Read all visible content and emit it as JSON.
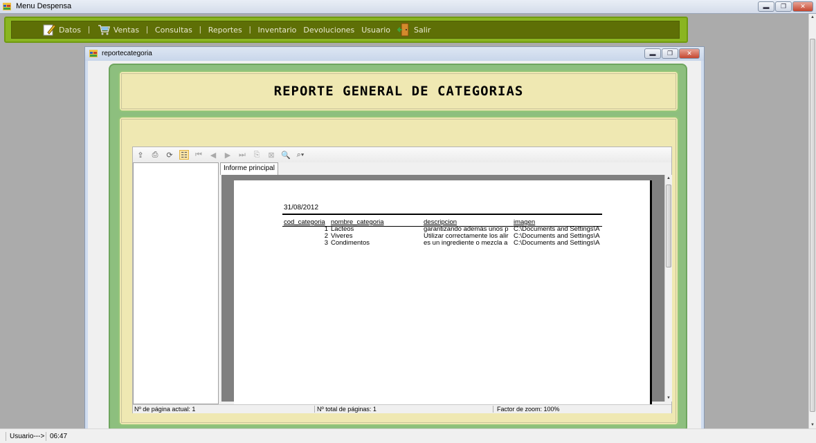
{
  "window": {
    "title": "Menu Despensa"
  },
  "menu": {
    "datos": "Datos",
    "ventas": "Ventas",
    "consultas": "Consultas",
    "reportes": "Reportes",
    "inventario": "Inventario",
    "devoluciones": "Devoluciones",
    "usuario": "Usuario",
    "salir": "Salir",
    "separator": "|"
  },
  "child_window": {
    "title": "reportecategoria"
  },
  "report": {
    "heading": "REPORTE GENERAL DE CATEGORIAS",
    "tab": "Informe principal",
    "date": "31/08/2012",
    "columns": [
      "cod_categoria",
      "nombre_categoria",
      "descripcion",
      "imagen"
    ],
    "rows": [
      {
        "cod": "1",
        "nombre": "Lacteos",
        "descripcion": "garantizando además unos p",
        "imagen": "C:\\Documents and Settings\\A"
      },
      {
        "cod": "2",
        "nombre": "Viveres",
        "descripcion": "Utilizar correctamente los alir",
        "imagen": "C:\\Documents and Settings\\A"
      },
      {
        "cod": "3",
        "nombre": "Condimentos",
        "descripcion": "es un ingrediente o mezcla a",
        "imagen": "C:\\Documents and Settings\\A"
      }
    ]
  },
  "viewer_status": {
    "current_page": "Nº de página actual: 1",
    "total_pages": "Nº total de páginas: 1",
    "zoom": "Factor de zoom: 100%"
  },
  "status": {
    "user": "Usuario--->",
    "time": "06:47"
  },
  "colors": {
    "menu_green": "#8ab521",
    "menu_dark": "#5e6f06",
    "panel_green": "#8dbf7e",
    "panel_cream": "#efe8b2"
  }
}
